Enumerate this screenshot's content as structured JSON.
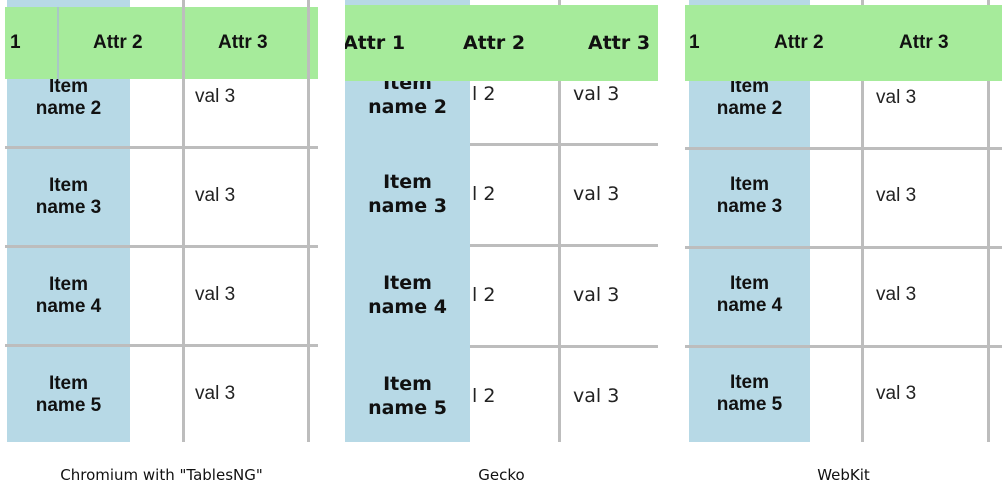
{
  "panels": [
    {
      "id": "chromium",
      "caption": "Chromium with \"TablesNG\"",
      "headers": [
        "1",
        "Attr 2",
        "Attr 3"
      ],
      "rows": [
        {
          "name": "Item name 2",
          "name_l1": "Item",
          "name_l2": "name 2",
          "attr2": "",
          "attr3": "val 3"
        },
        {
          "name": "Item name 3",
          "name_l1": "Item",
          "name_l2": "name 3",
          "attr2": "",
          "attr3": "val 3"
        },
        {
          "name": "Item name 4",
          "name_l1": "Item",
          "name_l2": "name 4",
          "attr2": "",
          "attr3": "val 3"
        },
        {
          "name": "Item name 5",
          "name_l1": "Item",
          "name_l2": "name 5",
          "attr2": "",
          "attr3": "val 3"
        }
      ]
    },
    {
      "id": "gecko",
      "caption": "Gecko",
      "headers": [
        "Attr 1",
        "Attr 2",
        "Attr 3"
      ],
      "rows": [
        {
          "name": "Item name 2",
          "name_l1": "Item",
          "name_l2": "name 2",
          "attr2": "l 2",
          "attr3": "val 3"
        },
        {
          "name": "Item name 3",
          "name_l1": "Item",
          "name_l2": "name 3",
          "attr2": "l 2",
          "attr3": "val 3"
        },
        {
          "name": "Item name 4",
          "name_l1": "Item",
          "name_l2": "name 4",
          "attr2": "l 2",
          "attr3": "val 3"
        },
        {
          "name": "Item name 5",
          "name_l1": "Item",
          "name_l2": "name 5",
          "attr2": "l 2",
          "attr3": "val 3"
        }
      ]
    },
    {
      "id": "webkit",
      "caption": "WebKit",
      "headers": [
        "1",
        "Attr 2",
        "Attr 3"
      ],
      "rows": [
        {
          "name": "Item name 2",
          "name_l1": "Item",
          "name_l2": "name 2",
          "attr2": "",
          "attr3": "val 3"
        },
        {
          "name": "Item name 3",
          "name_l1": "Item",
          "name_l2": "name 3",
          "attr2": "",
          "attr3": "val 3"
        },
        {
          "name": "Item name 4",
          "name_l1": "Item",
          "name_l2": "name 4",
          "attr2": "",
          "attr3": "val 3"
        },
        {
          "name": "Item name 5",
          "name_l1": "Item",
          "name_l2": "name 5",
          "attr2": "",
          "attr3": "val 3"
        }
      ]
    }
  ],
  "colors": {
    "header_bg": "#a6eb9b",
    "name_column_bg": "#b7d9e6",
    "border": "#bdbdbd"
  }
}
